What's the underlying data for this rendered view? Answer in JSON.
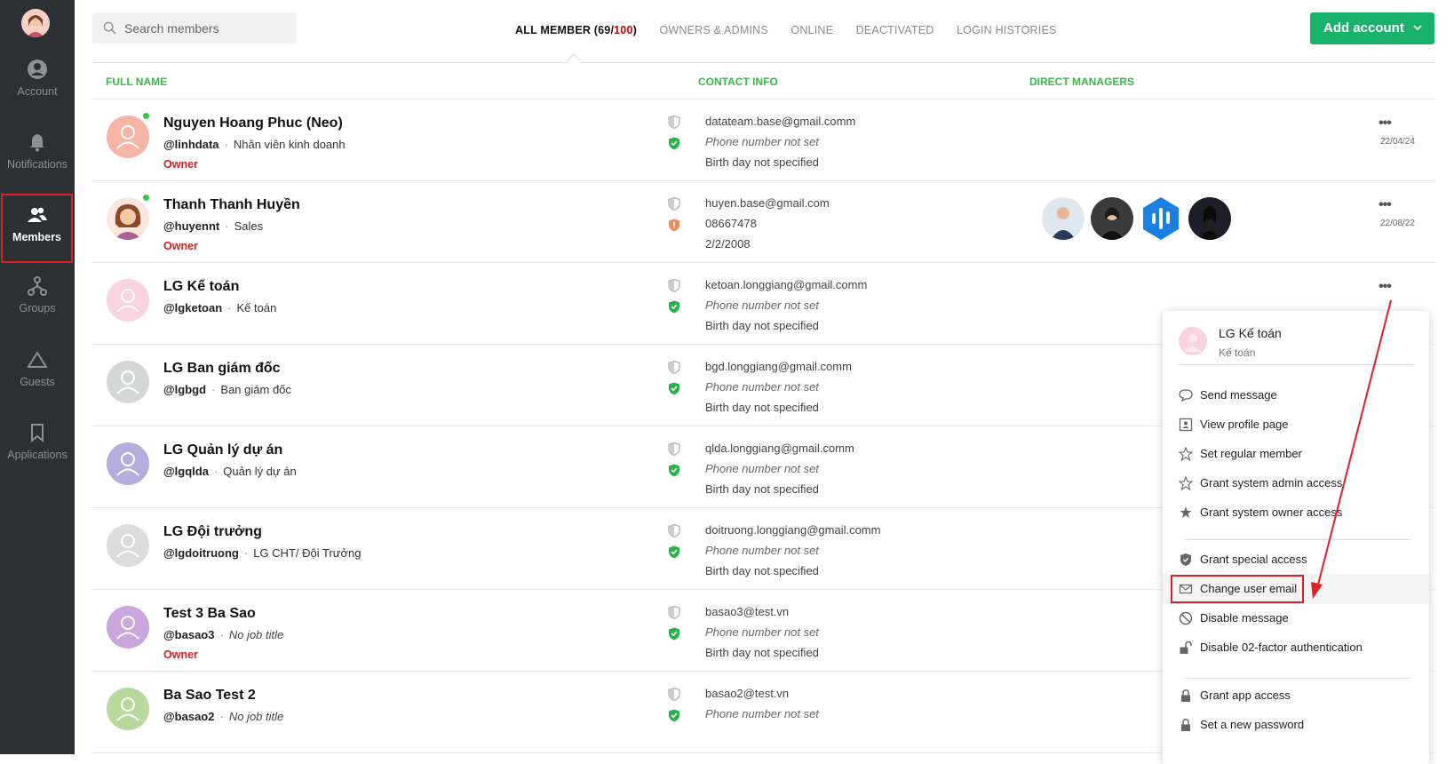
{
  "sidebar": {
    "items": [
      {
        "label": "Account",
        "icon": "user-circle-icon"
      },
      {
        "label": "Notifications",
        "icon": "bell-icon"
      },
      {
        "label": "Members",
        "icon": "members-icon",
        "active": true
      },
      {
        "label": "Groups",
        "icon": "groups-icon"
      },
      {
        "label": "Guests",
        "icon": "triangle-icon"
      },
      {
        "label": "Applications",
        "icon": "bookmark-icon"
      }
    ]
  },
  "search": {
    "placeholder": "Search members"
  },
  "tabs": {
    "all_prefix": "ALL MEMBER (",
    "all_count": "69",
    "all_sep": "/",
    "all_total": "100",
    "all_suffix": ")",
    "owners": "OWNERS & ADMINS",
    "online": "ONLINE",
    "deactivated": "DEACTIVATED",
    "login": "LOGIN HISTORIES"
  },
  "add_account": "Add account",
  "headers": {
    "full_name": "FULL NAME",
    "contact": "CONTACT INFO",
    "managers": "DIRECT MANAGERS"
  },
  "members": [
    {
      "name": "Nguyen Hoang Phuc (Neo)",
      "username": "@linhdata",
      "title": "Nhân viên kinh doanh",
      "role": "Owner",
      "email": "datateam.base@gmail.comm",
      "phone": "Phone number not set",
      "birthday": "Birth day not specified",
      "date": "22/04/24"
    },
    {
      "name": "Thanh Thanh Huyền",
      "username": "@huyennt",
      "title": "Sales",
      "role": "Owner",
      "email": "huyen.base@gmail.com",
      "phone": "08667478",
      "birthday": "2/2/2008",
      "date": "22/08/22"
    },
    {
      "name": "LG Kế toán",
      "username": "@lgketoan",
      "title": "Kế toán",
      "role": "",
      "email": "ketoan.longgiang@gmail.comm",
      "phone": "Phone number not set",
      "birthday": "Birth day not specified",
      "date": ""
    },
    {
      "name": "LG Ban giám đốc",
      "username": "@lgbgd",
      "title": "Ban giám đốc",
      "role": "",
      "email": "bgd.longgiang@gmail.comm",
      "phone": "Phone number not set",
      "birthday": "Birth day not specified",
      "date": ""
    },
    {
      "name": "LG Quản lý dự án",
      "username": "@lgqlda",
      "title": "Quản lý dự án",
      "role": "",
      "email": "qlda.longgiang@gmail.comm",
      "phone": "Phone number not set",
      "birthday": "Birth day not specified",
      "date": ""
    },
    {
      "name": "LG Đội trưởng",
      "username": "@lgdoitruong",
      "title": "LG CHT/ Đội Trưởng",
      "role": "",
      "email": "doitruong.longgiang@gmail.comm",
      "phone": "Phone number not set",
      "birthday": "Birth day not specified",
      "date": ""
    },
    {
      "name": "Test 3 Ba Sao",
      "username": "@basao3",
      "title": "No job title",
      "role": "Owner",
      "email": "basao3@test.vn",
      "phone": "Phone number not set",
      "birthday": "Birth day not specified",
      "date": ""
    },
    {
      "name": "Ba Sao Test 2",
      "username": "@basao2",
      "title": "No job title",
      "role": "",
      "email": "basao2@test.vn",
      "phone": "Phone number not set",
      "birthday": "",
      "date": ""
    }
  ],
  "menu": {
    "name": "LG Kế toán",
    "role": "Kế toán",
    "items": [
      {
        "label": "Send message",
        "icon": "chat-bubble-icon"
      },
      {
        "label": "View profile page",
        "icon": "profile-card-icon"
      },
      {
        "label": "Set regular member",
        "icon": "star-outline-icon"
      },
      {
        "label": "Grant system admin access",
        "icon": "star-outline-icon"
      },
      {
        "label": "Grant system owner access",
        "icon": "star-filled-icon"
      },
      {
        "label": "Grant special access",
        "icon": "shield-icon"
      },
      {
        "label": "Change user email",
        "icon": "envelope-icon"
      },
      {
        "label": "Disable message",
        "icon": "ban-icon"
      },
      {
        "label": "Disable 02-factor authentication",
        "icon": "unlock-icon"
      },
      {
        "label": "Grant app access",
        "icon": "lock-icon"
      },
      {
        "label": "Set a new password",
        "icon": "lock-icon"
      }
    ]
  },
  "colors": {
    "accent": "#18b26b",
    "header_green": "#3cb54a",
    "owner_red": "#d42020",
    "sidebar": "#2c2f33",
    "highlight": "#e01e26"
  }
}
